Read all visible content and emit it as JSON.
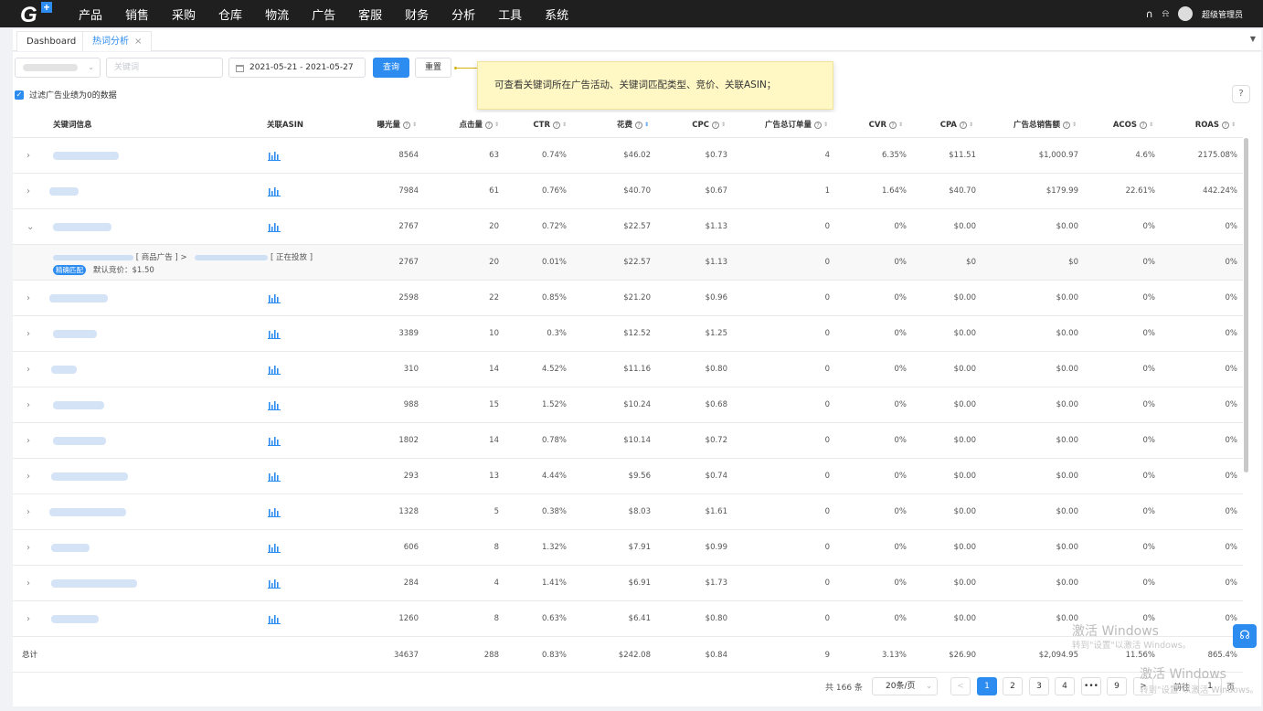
{
  "nav": {
    "menu": [
      "产品",
      "销售",
      "采购",
      "仓库",
      "物流",
      "广告",
      "客服",
      "财务",
      "分析",
      "工具",
      "系统"
    ],
    "username": "超级管理员"
  },
  "tabs": [
    {
      "label": "Dashboard"
    },
    {
      "label": "热词分析"
    }
  ],
  "filters": {
    "keyword_placeholder": "关键词",
    "date_range": "2021-05-21  -  2021-05-27",
    "query_label": "查询",
    "reset_label": "重置",
    "filter_zero_label": "过滤广告业绩为0的数据"
  },
  "tooltip": "可查看关键词所在广告活动、关键词匹配类型、竞价、关联ASIN；",
  "columns": [
    "关键词信息",
    "关联ASIN",
    "曝光量",
    "点击量",
    "CTR",
    "花费",
    "CPC",
    "广告总订单量",
    "CVR",
    "CPA",
    "广告总销售额",
    "ACOS",
    "ROAS"
  ],
  "rows": [
    {
      "impr": "8564",
      "clicks": "63",
      "ctr": "0.74%",
      "spend": "$46.02",
      "cpc": "$0.73",
      "orders": "4",
      "cvr": "6.35%",
      "cpa": "$11.51",
      "sales": "$1,000.97",
      "acos": "4.6%",
      "roas": "2175.08%"
    },
    {
      "impr": "7984",
      "clicks": "61",
      "ctr": "0.76%",
      "spend": "$40.70",
      "cpc": "$0.67",
      "orders": "1",
      "cvr": "1.64%",
      "cpa": "$40.70",
      "sales": "$179.99",
      "acos": "22.61%",
      "roas": "442.24%"
    },
    {
      "impr": "2767",
      "clicks": "20",
      "ctr": "0.72%",
      "spend": "$22.57",
      "cpc": "$1.13",
      "orders": "0",
      "cvr": "0%",
      "cpa": "$0.00",
      "sales": "$0.00",
      "acos": "0%",
      "roas": "0%"
    },
    {
      "impr": "2767",
      "clicks": "20",
      "ctr": "0.01%",
      "spend": "$22.57",
      "cpc": "$1.13",
      "orders": "0",
      "cvr": "0%",
      "cpa": "$0",
      "sales": "$0",
      "acos": "0%",
      "roas": "0%"
    },
    {
      "impr": "2598",
      "clicks": "22",
      "ctr": "0.85%",
      "spend": "$21.20",
      "cpc": "$0.96",
      "orders": "0",
      "cvr": "0%",
      "cpa": "$0.00",
      "sales": "$0.00",
      "acos": "0%",
      "roas": "0%"
    },
    {
      "impr": "3389",
      "clicks": "10",
      "ctr": "0.3%",
      "spend": "$12.52",
      "cpc": "$1.25",
      "orders": "0",
      "cvr": "0%",
      "cpa": "$0.00",
      "sales": "$0.00",
      "acos": "0%",
      "roas": "0%"
    },
    {
      "impr": "310",
      "clicks": "14",
      "ctr": "4.52%",
      "spend": "$11.16",
      "cpc": "$0.80",
      "orders": "0",
      "cvr": "0%",
      "cpa": "$0.00",
      "sales": "$0.00",
      "acos": "0%",
      "roas": "0%"
    },
    {
      "impr": "988",
      "clicks": "15",
      "ctr": "1.52%",
      "spend": "$10.24",
      "cpc": "$0.68",
      "orders": "0",
      "cvr": "0%",
      "cpa": "$0.00",
      "sales": "$0.00",
      "acos": "0%",
      "roas": "0%"
    },
    {
      "impr": "1802",
      "clicks": "14",
      "ctr": "0.78%",
      "spend": "$10.14",
      "cpc": "$0.72",
      "orders": "0",
      "cvr": "0%",
      "cpa": "$0.00",
      "sales": "$0.00",
      "acos": "0%",
      "roas": "0%"
    },
    {
      "impr": "293",
      "clicks": "13",
      "ctr": "4.44%",
      "spend": "$9.56",
      "cpc": "$0.74",
      "orders": "0",
      "cvr": "0%",
      "cpa": "$0.00",
      "sales": "$0.00",
      "acos": "0%",
      "roas": "0%"
    },
    {
      "impr": "1328",
      "clicks": "5",
      "ctr": "0.38%",
      "spend": "$8.03",
      "cpc": "$1.61",
      "orders": "0",
      "cvr": "0%",
      "cpa": "$0.00",
      "sales": "$0.00",
      "acos": "0%",
      "roas": "0%"
    },
    {
      "impr": "606",
      "clicks": "8",
      "ctr": "1.32%",
      "spend": "$7.91",
      "cpc": "$0.99",
      "orders": "0",
      "cvr": "0%",
      "cpa": "$0.00",
      "sales": "$0.00",
      "acos": "0%",
      "roas": "0%"
    },
    {
      "impr": "284",
      "clicks": "4",
      "ctr": "1.41%",
      "spend": "$6.91",
      "cpc": "$1.73",
      "orders": "0",
      "cvr": "0%",
      "cpa": "$0.00",
      "sales": "$0.00",
      "acos": "0%",
      "roas": "0%"
    },
    {
      "impr": "1260",
      "clicks": "8",
      "ctr": "0.63%",
      "spend": "$6.41",
      "cpc": "$0.80",
      "orders": "0",
      "cvr": "0%",
      "cpa": "$0.00",
      "sales": "$0.00",
      "acos": "0%",
      "roas": "0%"
    }
  ],
  "subrow": {
    "campaign_tag": "[ 商品广告 ] >",
    "status": "[ 正在投放 ]",
    "match_badge": "精确匹配",
    "bid_text": "默认竞价：$1.50"
  },
  "total": {
    "label": "总计",
    "impr": "34637",
    "clicks": "288",
    "ctr": "0.83%",
    "spend": "$242.08",
    "cpc": "$0.84",
    "orders": "9",
    "cvr": "3.13%",
    "cpa": "$26.90",
    "sales": "$2,094.95",
    "acos": "11.56%",
    "roas": "865.4%"
  },
  "pager": {
    "total": "共 166 条",
    "size": "20条/页",
    "pages": [
      "1",
      "2",
      "3",
      "4",
      "•••",
      "9"
    ],
    "goto_label": "前往",
    "goto_value": "1",
    "page_suffix": "页"
  },
  "watermark": {
    "title": "激活 Windows",
    "sub": "转到\"设置\"以激活 Windows。"
  },
  "colors": {
    "accent": "#2d8cf0",
    "nav_bg": "#1f1f1f",
    "tooltip_bg": "#fff8c4"
  }
}
